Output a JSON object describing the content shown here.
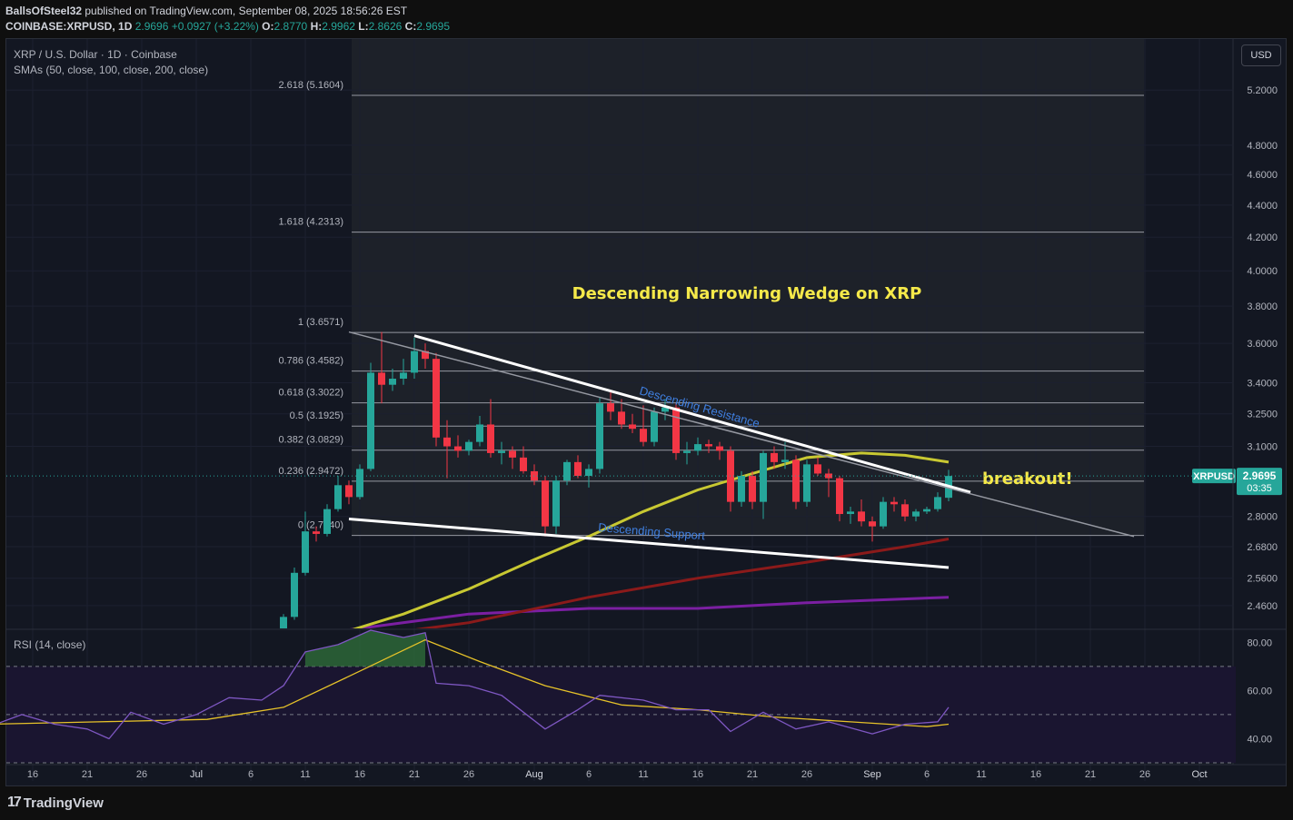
{
  "header": {
    "publisher_line_user": "BallsOfSteel32",
    "publisher_line_rest": " published on TradingView.com, September 08, 2025 18:56:26 EST",
    "symbol": "COINBASE:XRPUSD, 1D",
    "last": "2.9696",
    "change": "+0.0927 (+3.22%)",
    "o_label": "O:",
    "o": "2.8770",
    "h_label": "H:",
    "h": "2.9962",
    "l_label": "L:",
    "l": "2.8626",
    "c_label": "C:",
    "c": "2.9695"
  },
  "legend": {
    "title": "XRP / U.S. Dollar · 1D · Coinbase",
    "smas": "SMAs (50, close, 100, close, 200, close)",
    "rsi": "RSI (14, close)"
  },
  "currency_button": "USD",
  "price_tag": {
    "symbol": "XRPUSD",
    "price": "2.9695",
    "countdown": "03:35"
  },
  "annotations": {
    "title": "Descending Narrowing Wedge on XRP",
    "breakout": "breakout!",
    "resistance": "Descending Resistance",
    "support": "Descending Support"
  },
  "footer": {
    "brand": "TradingView"
  },
  "colors": {
    "bull": "#26a69a",
    "bear": "#f23645",
    "sma50": "#c8c832",
    "sma100": "#8b1a1a",
    "sma200": "#7b1fa2",
    "rsi": "#7e57c2",
    "rsi_ma": "#e6c229",
    "annotation": "#f5e94a",
    "trendline_label": "#3f7fe0"
  },
  "chart_data": [
    {
      "type": "candlestick",
      "title": "XRP / U.S. Dollar · 1D · Coinbase",
      "y_scale": "log",
      "ylim": [
        2.38,
        5.6
      ],
      "y_ticks": [
        5.2,
        4.8,
        4.6,
        4.4,
        4.2,
        4.0,
        3.8,
        3.6,
        3.4,
        3.25,
        3.1,
        2.8,
        2.68,
        2.56,
        2.46
      ],
      "x_ticks": [
        "16",
        "21",
        "26",
        "Jul",
        "6",
        "11",
        "16",
        "21",
        "26",
        "Aug",
        "6",
        "11",
        "16",
        "21",
        "26",
        "Sep",
        "6",
        "11",
        "16",
        "21",
        "26",
        "Oct"
      ],
      "fibonacci": [
        {
          "level": "2.618",
          "price": 5.1604
        },
        {
          "level": "1.618",
          "price": 4.2313
        },
        {
          "level": "1",
          "price": 3.6571
        },
        {
          "level": "0.786",
          "price": 3.4582
        },
        {
          "level": "0.618",
          "price": 3.3022
        },
        {
          "level": "0.5",
          "price": 3.1925
        },
        {
          "level": "0.382",
          "price": 3.0829
        },
        {
          "level": "0.236",
          "price": 2.9472
        },
        {
          "level": "0",
          "price": 2.724
        }
      ],
      "candles": [
        {
          "date": "2025-07-08",
          "o": 2.3,
          "h": 2.36,
          "l": 2.28,
          "c": 2.33
        },
        {
          "date": "2025-07-09",
          "o": 2.33,
          "h": 2.43,
          "l": 2.32,
          "c": 2.42
        },
        {
          "date": "2025-07-10",
          "o": 2.42,
          "h": 2.6,
          "l": 2.41,
          "c": 2.58
        },
        {
          "date": "2025-07-11",
          "o": 2.58,
          "h": 2.82,
          "l": 2.57,
          "c": 2.74
        },
        {
          "date": "2025-07-12",
          "o": 2.74,
          "h": 2.76,
          "l": 2.7,
          "c": 2.73
        },
        {
          "date": "2025-07-13",
          "o": 2.73,
          "h": 2.85,
          "l": 2.72,
          "c": 2.83
        },
        {
          "date": "2025-07-14",
          "o": 2.83,
          "h": 2.97,
          "l": 2.82,
          "c": 2.93
        },
        {
          "date": "2025-07-15",
          "o": 2.93,
          "h": 2.95,
          "l": 2.85,
          "c": 2.88
        },
        {
          "date": "2025-07-16",
          "o": 2.88,
          "h": 3.02,
          "l": 2.87,
          "c": 3.0
        },
        {
          "date": "2025-07-17",
          "o": 3.0,
          "h": 3.5,
          "l": 2.99,
          "c": 3.45
        },
        {
          "date": "2025-07-18",
          "o": 3.45,
          "h": 3.66,
          "l": 3.3,
          "c": 3.39
        },
        {
          "date": "2025-07-19",
          "o": 3.39,
          "h": 3.47,
          "l": 3.36,
          "c": 3.42
        },
        {
          "date": "2025-07-20",
          "o": 3.42,
          "h": 3.52,
          "l": 3.39,
          "c": 3.45
        },
        {
          "date": "2025-07-21",
          "o": 3.45,
          "h": 3.63,
          "l": 3.42,
          "c": 3.56
        },
        {
          "date": "2025-07-22",
          "o": 3.56,
          "h": 3.6,
          "l": 3.47,
          "c": 3.52
        },
        {
          "date": "2025-07-23",
          "o": 3.52,
          "h": 3.55,
          "l": 3.1,
          "c": 3.14
        },
        {
          "date": "2025-07-24",
          "o": 3.14,
          "h": 3.22,
          "l": 2.96,
          "c": 3.1
        },
        {
          "date": "2025-07-25",
          "o": 3.1,
          "h": 3.15,
          "l": 3.05,
          "c": 3.08
        },
        {
          "date": "2025-07-26",
          "o": 3.08,
          "h": 3.13,
          "l": 3.06,
          "c": 3.12
        },
        {
          "date": "2025-07-27",
          "o": 3.12,
          "h": 3.24,
          "l": 3.1,
          "c": 3.2
        },
        {
          "date": "2025-07-28",
          "o": 3.2,
          "h": 3.32,
          "l": 3.05,
          "c": 3.07
        },
        {
          "date": "2025-07-29",
          "o": 3.07,
          "h": 3.12,
          "l": 3.02,
          "c": 3.08
        },
        {
          "date": "2025-07-30",
          "o": 3.08,
          "h": 3.1,
          "l": 3.0,
          "c": 3.05
        },
        {
          "date": "2025-07-31",
          "o": 3.05,
          "h": 3.1,
          "l": 2.98,
          "c": 2.99
        },
        {
          "date": "2025-08-01",
          "o": 2.99,
          "h": 3.02,
          "l": 2.93,
          "c": 2.95
        },
        {
          "date": "2025-08-02",
          "o": 2.95,
          "h": 2.97,
          "l": 2.72,
          "c": 2.76
        },
        {
          "date": "2025-08-03",
          "o": 2.76,
          "h": 2.97,
          "l": 2.73,
          "c": 2.95
        },
        {
          "date": "2025-08-04",
          "o": 2.95,
          "h": 3.04,
          "l": 2.93,
          "c": 3.03
        },
        {
          "date": "2025-08-05",
          "o": 3.03,
          "h": 3.06,
          "l": 2.96,
          "c": 2.97
        },
        {
          "date": "2025-08-06",
          "o": 2.97,
          "h": 3.02,
          "l": 2.92,
          "c": 3.0
        },
        {
          "date": "2025-08-07",
          "o": 3.0,
          "h": 3.33,
          "l": 2.98,
          "c": 3.3
        },
        {
          "date": "2025-08-08",
          "o": 3.3,
          "h": 3.36,
          "l": 3.22,
          "c": 3.26
        },
        {
          "date": "2025-08-09",
          "o": 3.26,
          "h": 3.32,
          "l": 3.18,
          "c": 3.2
        },
        {
          "date": "2025-08-10",
          "o": 3.2,
          "h": 3.25,
          "l": 3.16,
          "c": 3.18
        },
        {
          "date": "2025-08-11",
          "o": 3.18,
          "h": 3.29,
          "l": 3.1,
          "c": 3.12
        },
        {
          "date": "2025-08-12",
          "o": 3.12,
          "h": 3.28,
          "l": 3.1,
          "c": 3.26
        },
        {
          "date": "2025-08-13",
          "o": 3.26,
          "h": 3.32,
          "l": 3.22,
          "c": 3.28
        },
        {
          "date": "2025-08-14",
          "o": 3.28,
          "h": 3.3,
          "l": 3.04,
          "c": 3.07
        },
        {
          "date": "2025-08-15",
          "o": 3.07,
          "h": 3.12,
          "l": 3.02,
          "c": 3.08
        },
        {
          "date": "2025-08-16",
          "o": 3.08,
          "h": 3.14,
          "l": 3.06,
          "c": 3.11
        },
        {
          "date": "2025-08-17",
          "o": 3.11,
          "h": 3.13,
          "l": 3.07,
          "c": 3.1
        },
        {
          "date": "2025-08-18",
          "o": 3.1,
          "h": 3.12,
          "l": 3.04,
          "c": 3.08
        },
        {
          "date": "2025-08-19",
          "o": 3.08,
          "h": 3.1,
          "l": 2.82,
          "c": 2.86
        },
        {
          "date": "2025-08-20",
          "o": 2.86,
          "h": 2.99,
          "l": 2.84,
          "c": 2.97
        },
        {
          "date": "2025-08-21",
          "o": 2.97,
          "h": 2.99,
          "l": 2.83,
          "c": 2.86
        },
        {
          "date": "2025-08-22",
          "o": 2.86,
          "h": 3.08,
          "l": 2.79,
          "c": 3.07
        },
        {
          "date": "2025-08-23",
          "o": 3.07,
          "h": 3.1,
          "l": 3.0,
          "c": 3.03
        },
        {
          "date": "2025-08-24",
          "o": 3.03,
          "h": 3.12,
          "l": 3.0,
          "c": 3.04
        },
        {
          "date": "2025-08-25",
          "o": 3.04,
          "h": 3.06,
          "l": 2.83,
          "c": 2.86
        },
        {
          "date": "2025-08-26",
          "o": 2.86,
          "h": 3.04,
          "l": 2.84,
          "c": 3.02
        },
        {
          "date": "2025-08-27",
          "o": 3.02,
          "h": 3.05,
          "l": 2.97,
          "c": 2.98
        },
        {
          "date": "2025-08-28",
          "o": 2.98,
          "h": 3.0,
          "l": 2.88,
          "c": 2.96
        },
        {
          "date": "2025-08-29",
          "o": 2.96,
          "h": 2.97,
          "l": 2.78,
          "c": 2.81
        },
        {
          "date": "2025-08-30",
          "o": 2.81,
          "h": 2.84,
          "l": 2.77,
          "c": 2.82
        },
        {
          "date": "2025-08-31",
          "o": 2.82,
          "h": 2.87,
          "l": 2.76,
          "c": 2.78
        },
        {
          "date": "2025-09-01",
          "o": 2.78,
          "h": 2.8,
          "l": 2.7,
          "c": 2.76
        },
        {
          "date": "2025-09-02",
          "o": 2.76,
          "h": 2.88,
          "l": 2.75,
          "c": 2.86
        },
        {
          "date": "2025-09-03",
          "o": 2.86,
          "h": 2.88,
          "l": 2.82,
          "c": 2.85
        },
        {
          "date": "2025-09-04",
          "o": 2.85,
          "h": 2.87,
          "l": 2.78,
          "c": 2.8
        },
        {
          "date": "2025-09-05",
          "o": 2.8,
          "h": 2.83,
          "l": 2.78,
          "c": 2.82
        },
        {
          "date": "2025-09-06",
          "o": 2.82,
          "h": 2.84,
          "l": 2.81,
          "c": 2.83
        },
        {
          "date": "2025-09-07",
          "o": 2.83,
          "h": 2.9,
          "l": 2.82,
          "c": 2.88
        },
        {
          "date": "2025-09-08",
          "o": 2.877,
          "h": 2.9962,
          "l": 2.8626,
          "c": 2.9695
        }
      ],
      "sma50": [
        {
          "date": "2025-07-14",
          "v": 2.36
        },
        {
          "date": "2025-07-20",
          "v": 2.43
        },
        {
          "date": "2025-07-26",
          "v": 2.52
        },
        {
          "date": "2025-08-01",
          "v": 2.63
        },
        {
          "date": "2025-08-06",
          "v": 2.72
        },
        {
          "date": "2025-08-11",
          "v": 2.82
        },
        {
          "date": "2025-08-16",
          "v": 2.91
        },
        {
          "date": "2025-08-21",
          "v": 2.98
        },
        {
          "date": "2025-08-26",
          "v": 3.05
        },
        {
          "date": "2025-08-31",
          "v": 3.07
        },
        {
          "date": "2025-09-04",
          "v": 3.06
        },
        {
          "date": "2025-09-08",
          "v": 3.03
        }
      ],
      "sma100": [
        {
          "date": "2025-07-16",
          "v": 2.35
        },
        {
          "date": "2025-07-26",
          "v": 2.4
        },
        {
          "date": "2025-08-06",
          "v": 2.49
        },
        {
          "date": "2025-08-16",
          "v": 2.56
        },
        {
          "date": "2025-08-26",
          "v": 2.62
        },
        {
          "date": "2025-09-04",
          "v": 2.68
        },
        {
          "date": "2025-09-08",
          "v": 2.71
        }
      ],
      "sma200": [
        {
          "date": "2025-06-12",
          "v": 2.37
        },
        {
          "date": "2025-06-22",
          "v": 2.33
        },
        {
          "date": "2025-07-06",
          "v": 2.33
        },
        {
          "date": "2025-07-16",
          "v": 2.38
        },
        {
          "date": "2025-07-26",
          "v": 2.43
        },
        {
          "date": "2025-08-06",
          "v": 2.45
        },
        {
          "date": "2025-08-16",
          "v": 2.45
        },
        {
          "date": "2025-08-26",
          "v": 2.47
        },
        {
          "date": "2025-09-08",
          "v": 2.49
        }
      ],
      "trendlines": [
        {
          "name": "Descending Resistance",
          "from": {
            "date": "2025-07-21",
            "v": 3.64
          },
          "to": {
            "date": "2025-09-10",
            "v": 2.9
          }
        },
        {
          "name": "Descending Support",
          "from": {
            "date": "2025-07-15",
            "v": 2.79
          },
          "to": {
            "date": "2025-09-08",
            "v": 2.6
          }
        },
        {
          "name": "",
          "from": {
            "date": "2025-07-15",
            "v": 3.66
          },
          "to": {
            "date": "2025-09-25",
            "v": 2.72
          }
        }
      ]
    },
    {
      "type": "line",
      "title": "RSI (14, close)",
      "ylim": [
        30,
        85
      ],
      "y_ticks": [
        80,
        60,
        40
      ],
      "bands": [
        70,
        50,
        30
      ],
      "series": [
        {
          "points": [
            {
              "date": "2025-06-12",
              "v": 45
            },
            {
              "date": "2025-06-15",
              "v": 50
            },
            {
              "date": "2025-06-18",
              "v": 46
            },
            {
              "date": "2025-06-21",
              "v": 44
            },
            {
              "date": "2025-06-23",
              "v": 40
            },
            {
              "date": "2025-06-25",
              "v": 51
            },
            {
              "date": "2025-06-28",
              "v": 46
            },
            {
              "date": "2025-07-01",
              "v": 50
            },
            {
              "date": "2025-07-04",
              "v": 57
            },
            {
              "date": "2025-07-07",
              "v": 56
            },
            {
              "date": "2025-07-09",
              "v": 62
            },
            {
              "date": "2025-07-11",
              "v": 76
            },
            {
              "date": "2025-07-14",
              "v": 79
            },
            {
              "date": "2025-07-17",
              "v": 85
            },
            {
              "date": "2025-07-20",
              "v": 82
            },
            {
              "date": "2025-07-22",
              "v": 84
            },
            {
              "date": "2025-07-23",
              "v": 63
            },
            {
              "date": "2025-07-26",
              "v": 62
            },
            {
              "date": "2025-07-29",
              "v": 58
            },
            {
              "date": "2025-08-02",
              "v": 44
            },
            {
              "date": "2025-08-05",
              "v": 52
            },
            {
              "date": "2025-08-07",
              "v": 58
            },
            {
              "date": "2025-08-11",
              "v": 56
            },
            {
              "date": "2025-08-14",
              "v": 52
            },
            {
              "date": "2025-08-17",
              "v": 52
            },
            {
              "date": "2025-08-19",
              "v": 43
            },
            {
              "date": "2025-08-22",
              "v": 51
            },
            {
              "date": "2025-08-25",
              "v": 44
            },
            {
              "date": "2025-08-28",
              "v": 47
            },
            {
              "date": "2025-09-01",
              "v": 42
            },
            {
              "date": "2025-09-04",
              "v": 46
            },
            {
              "date": "2025-09-07",
              "v": 47
            },
            {
              "date": "2025-09-08",
              "v": 53
            }
          ]
        },
        {
          "points": [
            {
              "date": "2025-06-12",
              "v": 46
            },
            {
              "date": "2025-06-22",
              "v": 47
            },
            {
              "date": "2025-07-02",
              "v": 48
            },
            {
              "date": "2025-07-09",
              "v": 53
            },
            {
              "date": "2025-07-16",
              "v": 68
            },
            {
              "date": "2025-07-22",
              "v": 81
            },
            {
              "date": "2025-07-27",
              "v": 72
            },
            {
              "date": "2025-08-02",
              "v": 62
            },
            {
              "date": "2025-08-09",
              "v": 54
            },
            {
              "date": "2025-08-16",
              "v": 52
            },
            {
              "date": "2025-08-23",
              "v": 49
            },
            {
              "date": "2025-08-30",
              "v": 47
            },
            {
              "date": "2025-09-06",
              "v": 45
            },
            {
              "date": "2025-09-08",
              "v": 46
            }
          ]
        }
      ]
    }
  ]
}
